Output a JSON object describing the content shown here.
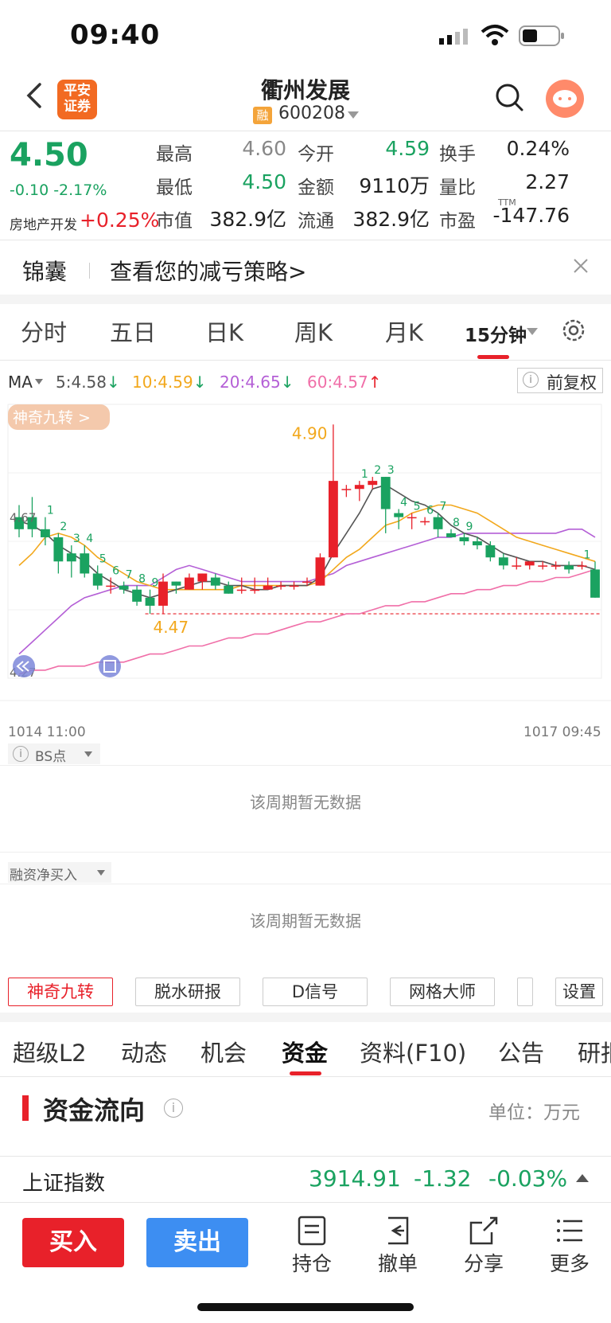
{
  "status_bar": {
    "time": "09:40"
  },
  "header": {
    "broker_logo": "平安证券",
    "stock_name": "衢州发展",
    "margin_tag": "融",
    "stock_code": "600208"
  },
  "quote": {
    "price": "4.50",
    "change": "-0.10 -2.17%",
    "sector_name": "房地产开发",
    "sector_change": "+0.25%",
    "fields": [
      {
        "label": "最高",
        "value": "4.60",
        "color": "gray"
      },
      {
        "label": "今开",
        "value": "4.59",
        "color": "green"
      },
      {
        "label": "换手",
        "value": "0.24%",
        "color": "black"
      },
      {
        "label": "最低",
        "value": "4.50",
        "color": "green"
      },
      {
        "label": "金额",
        "value": "9110万",
        "color": "black"
      },
      {
        "label": "量比",
        "value": "2.27",
        "color": "black"
      },
      {
        "label": "市值",
        "value": "382.9亿",
        "color": "black"
      },
      {
        "label": "流通",
        "value": "382.9亿",
        "color": "black"
      },
      {
        "label": "市盈",
        "value": "-147.76",
        "color": "black",
        "sup": "TTM"
      }
    ]
  },
  "tip": {
    "title": "锦囊",
    "text": "查看您的减亏策略>"
  },
  "kline_tabs": [
    "分时",
    "五日",
    "日K",
    "周K",
    "月K",
    "15分钟"
  ],
  "ma": {
    "label": "MA",
    "items": [
      {
        "text": "5:4.58",
        "arrow": "↓",
        "color": "#555555"
      },
      {
        "text": "10:4.59",
        "arrow": "↓",
        "color": "#f2a81d"
      },
      {
        "text": "20:4.65",
        "arrow": "↓",
        "color": "#b45fd6"
      },
      {
        "text": "60:4.57",
        "arrow": "↑",
        "color": "#f06fa8"
      }
    ],
    "adjust_label": "前复权"
  },
  "chart_data": {
    "type": "candlestick",
    "badge": "神奇九转 >",
    "y_left_labels": [
      "4.67",
      "4.27"
    ],
    "high_label": "4.90",
    "low_label": "4.47",
    "time_start": "1014 11:00",
    "time_end": "1017 09:45",
    "ylim": [
      4.27,
      4.95
    ],
    "candles": [
      [
        4.67,
        4.64,
        4.7,
        4.62
      ],
      [
        4.67,
        4.64,
        4.72,
        4.62
      ],
      [
        4.64,
        4.62,
        4.67,
        4.6
      ],
      [
        4.62,
        4.56,
        4.63,
        4.53
      ],
      [
        4.58,
        4.56,
        4.6,
        4.52
      ],
      [
        4.58,
        4.53,
        4.6,
        4.52
      ],
      [
        4.53,
        4.5,
        4.55,
        4.49
      ],
      [
        4.5,
        4.5,
        4.52,
        4.48
      ],
      [
        4.5,
        4.49,
        4.51,
        4.48
      ],
      [
        4.49,
        4.46,
        4.5,
        4.45
      ],
      [
        4.47,
        4.45,
        4.49,
        4.43
      ],
      [
        4.45,
        4.51,
        4.53,
        4.43
      ],
      [
        4.51,
        4.5,
        4.51,
        4.48
      ],
      [
        4.49,
        4.52,
        4.53,
        4.49
      ],
      [
        4.51,
        4.53,
        4.53,
        4.49
      ],
      [
        4.52,
        4.5,
        4.53,
        4.49
      ],
      [
        4.5,
        4.48,
        4.51,
        4.48
      ],
      [
        4.49,
        4.49,
        4.52,
        4.48
      ],
      [
        4.49,
        4.49,
        4.52,
        4.48
      ],
      [
        4.49,
        4.5,
        4.52,
        4.49
      ],
      [
        4.5,
        4.5,
        4.51,
        4.49
      ],
      [
        4.5,
        4.5,
        4.51,
        4.49
      ],
      [
        4.51,
        4.51,
        4.52,
        4.5
      ],
      [
        4.5,
        4.57,
        4.58,
        4.5
      ],
      [
        4.57,
        4.76,
        4.9,
        4.57
      ],
      [
        4.74,
        4.74,
        4.75,
        4.72
      ],
      [
        4.74,
        4.75,
        4.76,
        4.71
      ],
      [
        4.75,
        4.76,
        4.77,
        4.74
      ],
      [
        4.77,
        4.69,
        4.77,
        4.63
      ],
      [
        4.68,
        4.67,
        4.69,
        4.64
      ],
      [
        4.67,
        4.67,
        4.68,
        4.64
      ],
      [
        4.66,
        4.66,
        4.67,
        4.65
      ],
      [
        4.67,
        4.64,
        4.68,
        4.62
      ],
      [
        4.63,
        4.62,
        4.64,
        4.62
      ],
      [
        4.62,
        4.61,
        4.63,
        4.6
      ],
      [
        4.61,
        4.6,
        4.62,
        4.59
      ],
      [
        4.6,
        4.57,
        4.61,
        4.56
      ],
      [
        4.57,
        4.55,
        4.58,
        4.54
      ],
      [
        4.55,
        4.55,
        4.57,
        4.54
      ],
      [
        4.55,
        4.56,
        4.56,
        4.54
      ],
      [
        4.55,
        4.55,
        4.56,
        4.54
      ],
      [
        4.55,
        4.55,
        4.56,
        4.54
      ],
      [
        4.55,
        4.54,
        4.56,
        4.53
      ],
      [
        4.55,
        4.55,
        4.56,
        4.54
      ],
      [
        4.54,
        4.47,
        4.56,
        4.47
      ]
    ],
    "td_labels": [
      {
        "i": 2,
        "t": "1",
        "c": "green"
      },
      {
        "i": 3,
        "t": "2",
        "c": "green"
      },
      {
        "i": 4,
        "t": "3",
        "c": "green"
      },
      {
        "i": 5,
        "t": "4",
        "c": "green"
      },
      {
        "i": 6,
        "t": "5",
        "c": "green"
      },
      {
        "i": 7,
        "t": "6",
        "c": "green"
      },
      {
        "i": 8,
        "t": "7",
        "c": "green"
      },
      {
        "i": 9,
        "t": "8",
        "c": "green"
      },
      {
        "i": 10,
        "t": "9",
        "c": "green"
      },
      {
        "i": 26,
        "t": "1",
        "c": "green"
      },
      {
        "i": 27,
        "t": "2",
        "c": "green"
      },
      {
        "i": 28,
        "t": "3",
        "c": "green"
      },
      {
        "i": 29,
        "t": "4",
        "c": "green"
      },
      {
        "i": 30,
        "t": "5",
        "c": "green"
      },
      {
        "i": 31,
        "t": "6",
        "c": "green"
      },
      {
        "i": 32,
        "t": "7",
        "c": "green"
      },
      {
        "i": 33,
        "t": "8",
        "c": "green"
      },
      {
        "i": 34,
        "t": "9",
        "c": "green"
      },
      {
        "i": 43,
        "t": "1",
        "c": "green"
      }
    ],
    "ma5": [
      4.66,
      4.65,
      4.63,
      4.6,
      4.58,
      4.56,
      4.53,
      4.51,
      4.49,
      4.48,
      4.47,
      4.48,
      4.49,
      4.5,
      4.51,
      4.51,
      4.5,
      4.5,
      4.49,
      4.49,
      4.5,
      4.5,
      4.5,
      4.52,
      4.58,
      4.63,
      4.68,
      4.74,
      4.75,
      4.73,
      4.71,
      4.7,
      4.68,
      4.65,
      4.63,
      4.62,
      4.6,
      4.58,
      4.57,
      4.56,
      4.56,
      4.55,
      4.55,
      4.55,
      4.54
    ],
    "ma10": [
      4.55,
      4.58,
      4.62,
      4.63,
      4.62,
      4.6,
      4.57,
      4.55,
      4.53,
      4.51,
      4.5,
      4.49,
      4.49,
      4.49,
      4.49,
      4.49,
      4.49,
      4.5,
      4.5,
      4.5,
      4.5,
      4.5,
      4.5,
      4.51,
      4.54,
      4.57,
      4.59,
      4.62,
      4.65,
      4.66,
      4.68,
      4.69,
      4.7,
      4.7,
      4.69,
      4.68,
      4.66,
      4.64,
      4.62,
      4.61,
      4.6,
      4.59,
      4.58,
      4.57,
      4.56
    ],
    "ma20": [
      4.33,
      4.36,
      4.39,
      4.42,
      4.45,
      4.47,
      4.48,
      4.49,
      4.5,
      4.5,
      4.5,
      4.52,
      4.54,
      4.55,
      4.54,
      4.53,
      4.52,
      4.51,
      4.51,
      4.51,
      4.51,
      4.51,
      4.51,
      4.52,
      4.53,
      4.55,
      4.56,
      4.57,
      4.58,
      4.59,
      4.6,
      4.61,
      4.62,
      4.62,
      4.63,
      4.63,
      4.63,
      4.63,
      4.63,
      4.63,
      4.63,
      4.63,
      4.64,
      4.64,
      4.62
    ],
    "ma60": [
      4.28,
      4.29,
      4.29,
      4.3,
      4.3,
      4.3,
      4.31,
      4.31,
      4.31,
      4.32,
      4.33,
      4.33,
      4.34,
      4.35,
      4.35,
      4.36,
      4.37,
      4.37,
      4.38,
      4.38,
      4.39,
      4.4,
      4.41,
      4.41,
      4.42,
      4.43,
      4.43,
      4.44,
      4.45,
      4.45,
      4.46,
      4.46,
      4.47,
      4.48,
      4.48,
      4.49,
      4.49,
      4.5,
      4.5,
      4.51,
      4.51,
      4.52,
      4.52,
      4.53,
      4.54
    ]
  },
  "bs_section": {
    "label": "BS点",
    "empty_text": "该周期暂无数据"
  },
  "margin_section": {
    "label": "融资净买入",
    "empty_text": "该周期暂无数据"
  },
  "tools": [
    "神奇九转",
    "脱水研报",
    "D信号",
    "网格大师",
    "设置"
  ],
  "bottom_tabs": [
    "超级L2",
    "动态",
    "机会",
    "资金",
    "资料(F10)",
    "公告",
    "研报"
  ],
  "capital_flow": {
    "title": "资金流向",
    "unit": "单位：万元"
  },
  "index_row": {
    "name": "上证指数",
    "value": "3914.91",
    "change": "-1.32",
    "pct": "-0.03%"
  },
  "actions": {
    "buy": "买入",
    "sell": "卖出",
    "hold": "持仓",
    "cancel": "撤单",
    "share": "分享",
    "more": "更多"
  },
  "colors": {
    "up": "#e8212a",
    "down": "#1aa260",
    "sell_btn": "#3d8ef2"
  }
}
